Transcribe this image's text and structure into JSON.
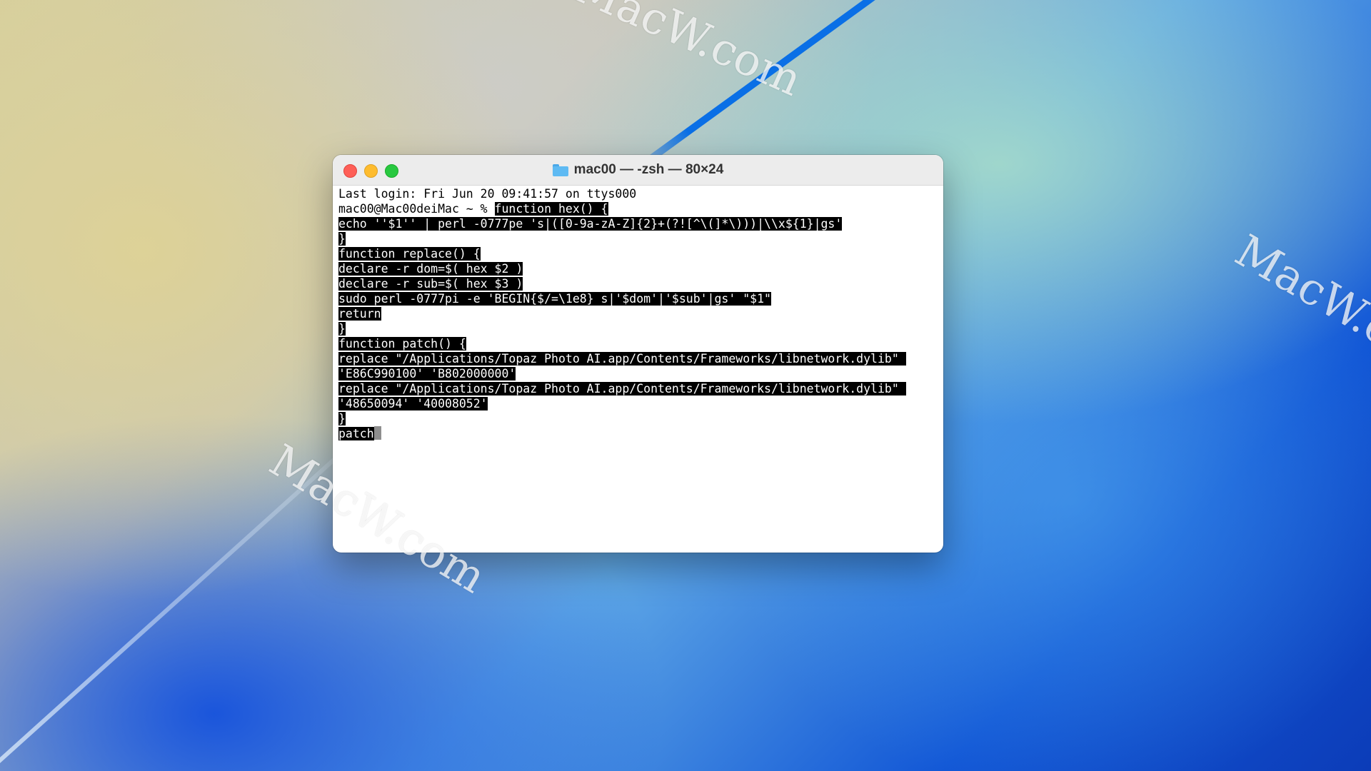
{
  "window": {
    "title": "mac00 — -zsh — 80×24"
  },
  "terminal": {
    "last_login": "Last login: Fri Jun 20 09:41:57 on ttys000",
    "prompt": "mac00@Mac00deiMac ~ % ",
    "lines": [
      "function hex() {",
      "echo ''$1'' | perl -0777pe 's|([0-9a-zA-Z]{2}+(?![^\\(]*\\)))|\\\\x${1}|gs'",
      "}",
      "function replace() {",
      "declare -r dom=$( hex $2 )",
      "declare -r sub=$( hex $3 )",
      "sudo perl -0777pi -e 'BEGIN{$/=\\1e8} s|'$dom'|'$sub'|gs' \"$1\"",
      "return",
      "}",
      "function patch() {",
      "replace \"/Applications/Topaz Photo AI.app/Contents/Frameworks/libnetwork.dylib\" ",
      "'E86C990100' 'B802000000'",
      "replace \"/Applications/Topaz Photo AI.app/Contents/Frameworks/libnetwork.dylib\" ",
      "'48650094' '40008052'",
      "}",
      "patch"
    ]
  },
  "watermarks": [
    "MacW.com",
    "MacW.com",
    "MacW.c"
  ],
  "icons": {
    "folder": "folder-icon"
  }
}
